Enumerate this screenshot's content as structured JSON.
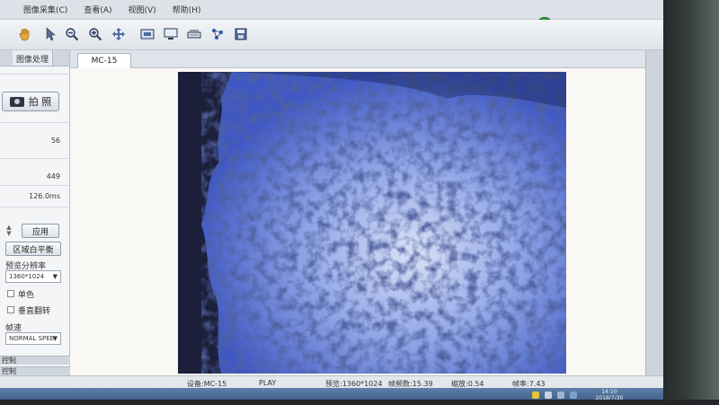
{
  "menu": {
    "items": [
      "图像采集(C)",
      "查看(A)",
      "视图(V)",
      "帮助(H)"
    ]
  },
  "toolbar": {
    "buttons": [
      {
        "icon": "hand-icon"
      },
      {
        "icon": "pointer-icon"
      },
      {
        "icon": "zoom-out-icon"
      },
      {
        "icon": "zoom-in-icon"
      },
      {
        "icon": "move-icon"
      },
      {
        "icon": "capture-screen-icon"
      },
      {
        "icon": "monitor-icon"
      },
      {
        "icon": "scanner-icon"
      },
      {
        "icon": "network-icon"
      },
      {
        "icon": "save-icon"
      }
    ]
  },
  "left_panel": {
    "tab_label": "图像处理",
    "capture_label": "拍 照",
    "values": [
      "56",
      "449",
      "126.0ms"
    ],
    "apply_label": "应用",
    "white_balance_label": "区域白平衡",
    "resolution_label": "预览分辨率",
    "resolution_value": "1360*1024",
    "mono_label": "单色",
    "flip_label": "垂直翻转",
    "speed_label": "帧速",
    "speed_value": "NORMAL SPEE",
    "section_labels": [
      "控制",
      "控制"
    ]
  },
  "document": {
    "tab_label": "MC-15"
  },
  "status": {
    "device": "设备:MC-15",
    "mode": "PLAY",
    "resolution": "预览:1360*1024",
    "frame_count": "帧频数:15.39",
    "scale": "缩放:0.54",
    "frame_rate": "帧率:7.43"
  },
  "taskbar": {
    "time": "14:10",
    "date": "2018/7/30"
  },
  "colors": {
    "micrograph_dark": "#1f2440",
    "micrograph_blue": "#3c56c8",
    "micrograph_light": "#cfd8f2",
    "taskbar": "#4a6b95",
    "status_indicator": "#2f9c3a"
  }
}
